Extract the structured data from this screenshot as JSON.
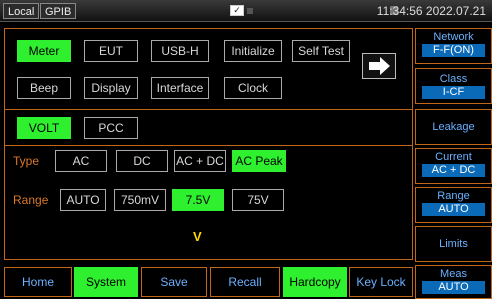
{
  "topbar": {
    "tabs": [
      "Local",
      "GPIB"
    ],
    "datetime": "11:34:56 2022.07.21"
  },
  "menu": {
    "row1": [
      "Meter",
      "EUT",
      "USB-H",
      "Initialize",
      "Self Test"
    ],
    "row2": [
      "Beep",
      "Display",
      "Interface",
      "Clock"
    ],
    "active": "Meter"
  },
  "mode": {
    "options": [
      "VOLT",
      "PCC"
    ],
    "active": "VOLT"
  },
  "type": {
    "label": "Type",
    "options": [
      "AC",
      "DC",
      "AC + DC",
      "AC Peak"
    ],
    "active": "AC Peak"
  },
  "range": {
    "label": "Range",
    "options": [
      "AUTO",
      "750mV",
      "7.5V",
      "75V"
    ],
    "active": "7.5V"
  },
  "unit": "V",
  "side": {
    "network": {
      "title": "Network",
      "value": "F-F(ON)"
    },
    "class": {
      "title": "Class",
      "value": "I-CF"
    },
    "leakage": {
      "title": "Leakage"
    },
    "current": {
      "title": "Current",
      "value": "AC + DC"
    },
    "range": {
      "title": "Range",
      "value": "AUTO"
    },
    "limits": {
      "title": "Limits"
    },
    "meas": {
      "title": "Meas",
      "value": "AUTO"
    }
  },
  "fkeys": [
    "Home",
    "System",
    "Save",
    "Recall",
    "Hardcopy",
    "Key Lock"
  ],
  "fkeys_active": [
    "System",
    "Hardcopy"
  ],
  "colors": {
    "accent_green": "#2ef02e",
    "frame_orange": "#c06818",
    "side_blue": "#6ab0ff",
    "unit_yellow": "#ffd800"
  }
}
